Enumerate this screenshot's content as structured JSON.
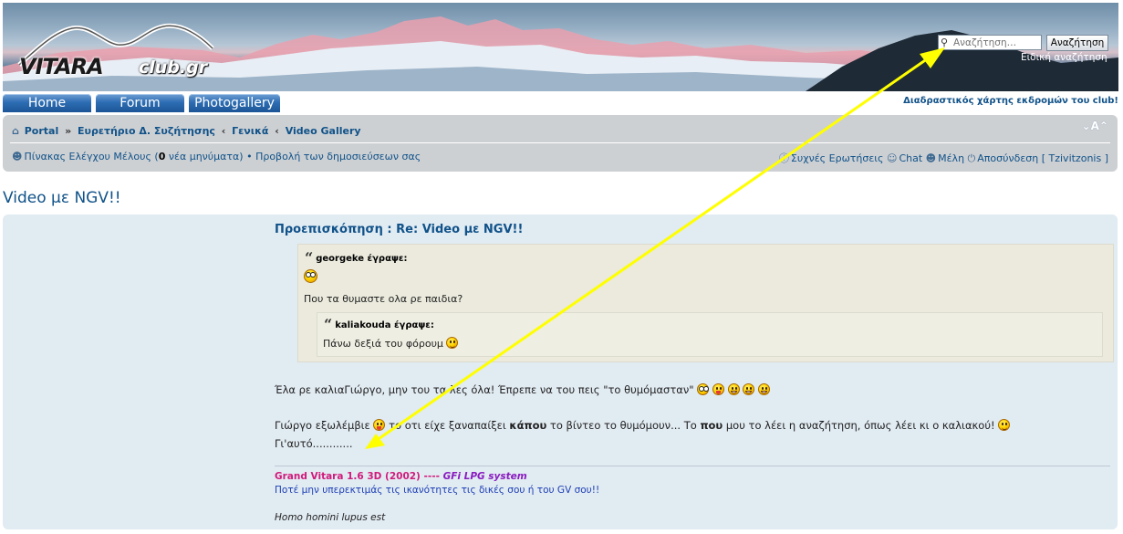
{
  "header": {
    "logo_main": "VITARA",
    "logo_sub": "club.gr",
    "search_placeholder": "Αναζήτηση…",
    "search_button": "Αναζήτηση",
    "advanced_search": "Ειδική αναζήτηση"
  },
  "nav": {
    "home": "Home",
    "forum": "Forum",
    "photogallery": "Photogallery",
    "map_link": "Διαδραστικός χάρτης εκδρομών του club!"
  },
  "breadcrumb": {
    "portal": "Portal",
    "index": "Ευρετήριο Δ. Συζήτησης",
    "general": "Γενικά",
    "video_gallery": "Video Gallery",
    "font_size": "⌄A⌃"
  },
  "userbar": {
    "ucp_prefix": "Πίνακας Ελέγχου Μέλους (",
    "new_count": "0",
    "ucp_suffix": " νέα μηνύματα)",
    "bullet": " • ",
    "view_posts": "Προβολή των δημοσιεύσεων σας",
    "faq": "Συχνές Ερωτήσεις",
    "chat": "Chat",
    "members": "Μέλη",
    "logout": "Αποσύνδεση [ Tzivitzonis ]"
  },
  "topic": {
    "title": "Video με NGV!!"
  },
  "post": {
    "preview_title": "Προεπισκόπηση : Re: Video με NGV!!",
    "quote1_author": "georgeke έγραψε:",
    "quote1_text": "Που τα θυμαστε ολα ρε παιδια?",
    "quote2_author": "kaliakouda έγραψε:",
    "quote2_text": "Πάνω δεξιά του φόρουμ",
    "line1": "Έλα ρε καλιαΓιώργο, μην του τα λες όλα! Έπρεπε να του πεις \"το θυμόμασταν\"",
    "line2_a": "Γιώργο εξωλέμβιε",
    "line2_b": " το οτι είχε ξαναπαίξει ",
    "line2_bold1": "κάπου",
    "line2_c": " το βίντεο το θυμόμουν... Το ",
    "line2_bold2": "που",
    "line2_d": " μου το λέει η αναζήτηση, όπως λέει κι ο καλιακού!",
    "line3": "Γι'αυτό............"
  },
  "signature": {
    "car": "Grand Vitara 1.6 3D (2002) ---- ",
    "car_lpg": "GFi LPG system",
    "motto": "Ποτέ μην υπερεκτιμάς τις ικανότητες τις δικές σου ή του GV σου!!",
    "latin": "Homo homini lupus est"
  },
  "colors": {
    "link": "#105289",
    "panel": "#e1ebf2",
    "quote_bg": "#ebeadd",
    "annotation_arrow": "#ffff00",
    "signature_car": "#d11a7b",
    "signature_motto": "#1d3fb5"
  }
}
